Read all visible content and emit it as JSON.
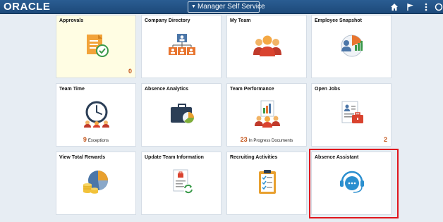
{
  "header": {
    "logo": "ORACLE",
    "homepage_selector": "Manager Self Service",
    "icons": [
      "home-icon",
      "flag-icon",
      "more-vertical-icon",
      "navbar-icon"
    ]
  },
  "tiles": [
    {
      "title": "Approvals",
      "badge": "0",
      "icon": "approvals-document-check-icon"
    },
    {
      "title": "Company Directory",
      "icon": "org-chart-icon"
    },
    {
      "title": "My Team",
      "icon": "team-people-icon"
    },
    {
      "title": "Employee Snapshot",
      "icon": "employee-snapshot-icon"
    },
    {
      "title": "Team Time",
      "metric_value": "9",
      "metric_label": "Exceptions",
      "icon": "team-time-clock-icon"
    },
    {
      "title": "Absence Analytics",
      "icon": "briefcase-pie-icon"
    },
    {
      "title": "Team Performance",
      "metric_value": "23",
      "metric_label": "In Progress Documents",
      "icon": "performance-report-icon"
    },
    {
      "title": "Open Jobs",
      "badge": "2",
      "icon": "open-jobs-icon"
    },
    {
      "title": "View Total Rewards",
      "icon": "rewards-pie-coins-icon"
    },
    {
      "title": "Update Team Information",
      "icon": "update-document-icon"
    },
    {
      "title": "Recruiting Activities",
      "icon": "clipboard-checklist-icon"
    },
    {
      "title": "Absence Assistant",
      "icon": "chat-assistant-icon"
    }
  ],
  "colors": {
    "header": "#1d4a7a",
    "badge": "#c4551a",
    "highlight_border": "#e0161e",
    "approvals_bg": "#fffde3"
  }
}
